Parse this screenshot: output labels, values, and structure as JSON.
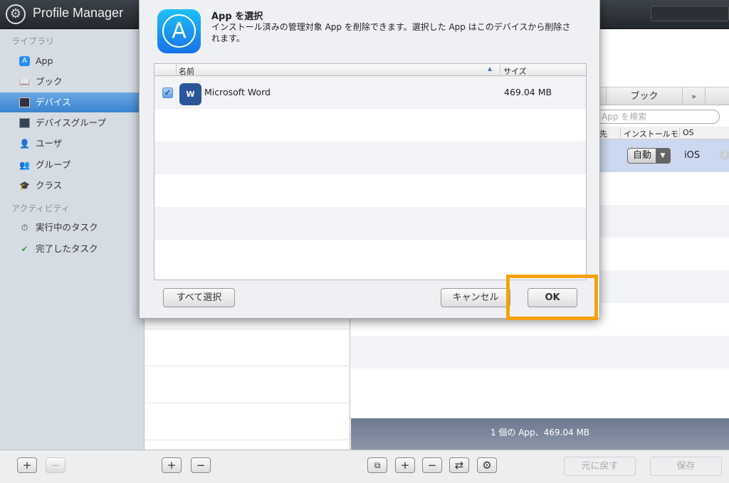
{
  "app": {
    "title": "Profile Manager",
    "logo_icon": "gear-icon"
  },
  "sidebar": {
    "sections": [
      {
        "label": "ライブラリ"
      },
      {
        "label": "アクティビティ"
      }
    ],
    "items": [
      {
        "label": "App",
        "icon": "app-store-icon"
      },
      {
        "label": "ブック",
        "icon": "book-icon"
      },
      {
        "label": "デバイス",
        "icon": "monitor-icon",
        "selected": true
      },
      {
        "label": "デバイスグループ",
        "icon": "device-group-icon"
      },
      {
        "label": "ユーザ",
        "icon": "user-icon"
      },
      {
        "label": "グループ",
        "icon": "group-icon"
      },
      {
        "label": "クラス",
        "icon": "graduation-cap-icon"
      },
      {
        "label": "実行中のタスク",
        "icon": "timer-icon"
      },
      {
        "label": "完了したタスク",
        "icon": "check-timer-icon"
      }
    ]
  },
  "right_panel": {
    "tabs": [
      {
        "label": "ブック"
      },
      {
        "label": "»"
      }
    ],
    "search_placeholder": "App を検索",
    "columns": [
      "先",
      "インストールモ",
      "OS"
    ],
    "row": {
      "install_mode": "自動",
      "os": "iOS"
    },
    "status": "1 個の App、469.04 MB",
    "revert_label": "元に戻す",
    "save_label": "保存"
  },
  "dialog": {
    "title": "App を選択",
    "description": "インストール済みの管理対象 App を削除できます。選択した App はこのデバイスから削除されます。",
    "columns": {
      "name": "名前",
      "size": "サイズ"
    },
    "rows": [
      {
        "name": "Microsoft Word",
        "size": "469.04 MB",
        "checked": true
      }
    ],
    "select_all_label": "すべて選択",
    "cancel_label": "キャンセル",
    "ok_label": "OK",
    "highlight_color": "#f3a20c"
  }
}
